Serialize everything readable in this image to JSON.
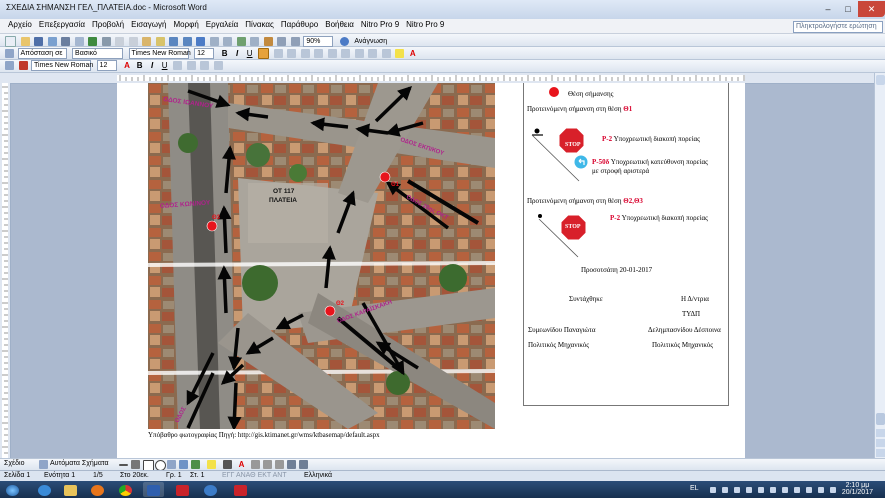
{
  "window": {
    "title": "ΣΧΕΔΙΑ ΣΗΜΑΝΣΗ ΓΕΛ_ΠΛΑΤΕΙΑ.doc - Microsoft Word",
    "minimize": "–",
    "maximize": "□",
    "close": "✕"
  },
  "menu": {
    "items": [
      "Αρχείο",
      "Επεξεργασία",
      "Προβολή",
      "Εισαγωγή",
      "Μορφή",
      "Εργαλεία",
      "Πίνακας",
      "Παράθυρο",
      "Βοήθεια",
      "Nitro Pro 9",
      "Nitro Pro 9"
    ],
    "help_placeholder": "Πληκτρολογήστε ερώτηση"
  },
  "toolbar": {
    "zoom": "90%",
    "reading_label": "Ανάγνωση",
    "style_value": "Απόσταση σε",
    "style2_value": "Βασικό",
    "font_value": "Times New Roman",
    "size_value": "12",
    "font2_value": "Times New Roman",
    "size2_value": "12"
  },
  "map": {
    "labels": {
      "street_top": "ΟΔΟΣ ΙΩΑΝΝΟΥ",
      "street_left": "ΟΔΟΣ ΚΩΝ/ΝΟΥ",
      "street_right_top": "ΟΔΟΣ ΕΚΠ/ΚΟΥ",
      "street_right_mid": "ΟΔΟΣ 28ης ΟΚΤ",
      "street_mid_right": "ΟΔΟΣ ΚΑΡΑΪΣΚΑΚΗ",
      "street_bottom_left": "ΟΔΟΣ",
      "square_name": "ΟΤ 117",
      "square_word": "ΠΛΑΤΕΙΑ",
      "point1": "Θ1",
      "point2": "Θ2",
      "point3": "Θ3"
    }
  },
  "caption": "Υπόβαθρο φωτογραφίας Πηγή: http://gis.ktimanet.gr/wms/ktbasemap/default.aspx",
  "signbox": {
    "legend_text": "Θέση σήμανσης",
    "proposal1": "Προτεινόμενη σήμανση στη θέση",
    "proposal1_point": "Θ1",
    "sign_p2_code": "Ρ-2",
    "sign_p2_text": "Υποχρεωτική διακοπή πορείας",
    "sign_p50_code": "Ρ-50δ",
    "sign_p50_text": "Υποχρεωτική κατεύθυνση πορείας",
    "sign_p50_text2": "με στροφή αριστερά",
    "proposal2": "Προτεινόμενη σήμανση στη θέση",
    "proposal2_point": "Θ2,Θ3",
    "sign_p2b_code": "Ρ-2",
    "sign_p2b_text": "Υποχρεωτική διακοπή πορείας",
    "stop_text": "STOP",
    "date_line": "Προσοτσάπη 20-01-2017",
    "composed": "Συντάχθηκε",
    "director": "Η Δ/ντρια",
    "dept": "ΤΥΔΠ",
    "name_left": "Συμεωνίδου Παναγιώτα",
    "name_right": "Δελημπασνίδου Δέσποινα",
    "role_left": "Πολιτικός Μηχανικός",
    "role_right": "Πολιτικός Μηχανικός"
  },
  "drawing_toolbar": {
    "draw_label": "Σχέδιο",
    "autoshapes_label": "Αυτόματα Σχήματα"
  },
  "status": {
    "section": "Σελίδα 1",
    "ensotita": "Ενότητα 1",
    "pages": "1/5",
    "at": "Στο 20εκ.",
    "line": "Γρ. 1",
    "col": "Στ. 1",
    "modes": "ΕΓΓ  ΑΝΑΘ  ΕΚΤ  ΑΝΤ",
    "lang": "Ελληνικά"
  },
  "taskbar": {
    "lang": "EL",
    "time": "2:10 μμ",
    "date": "20/1/2017"
  },
  "colors": {
    "marker_red": "#e8141c",
    "stop_red": "#d8202a",
    "street_label": "#b0228c",
    "arrow": "#050505"
  }
}
